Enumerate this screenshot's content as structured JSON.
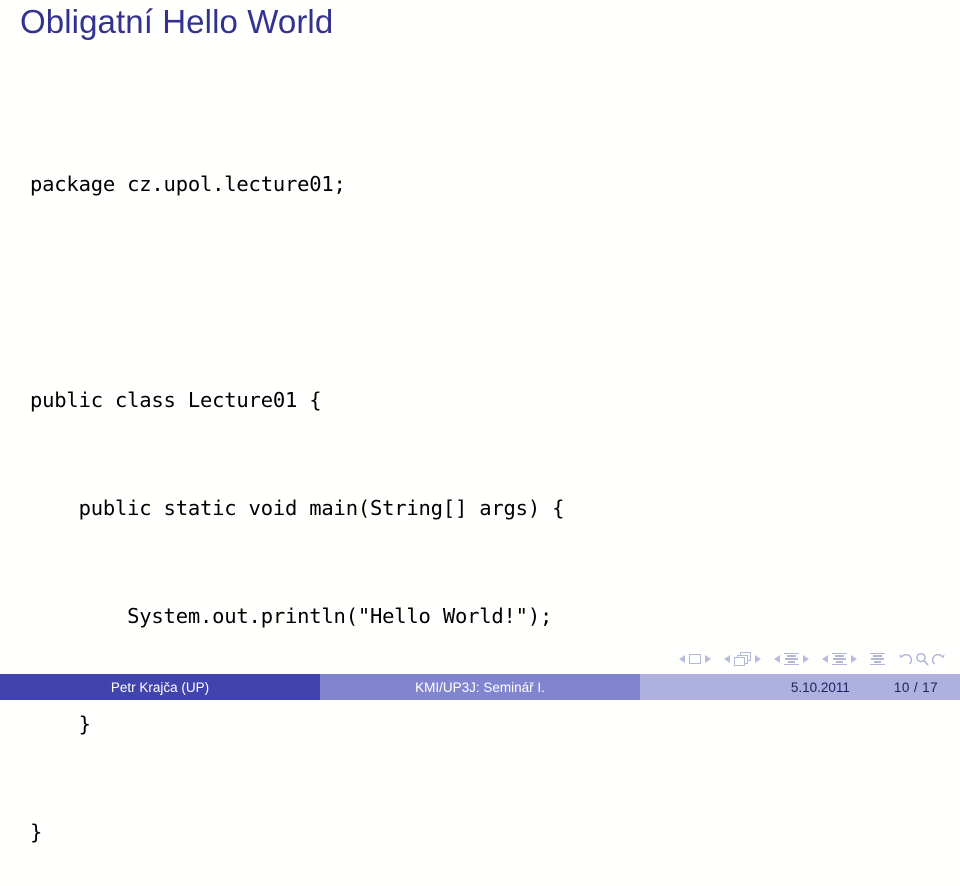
{
  "slide": {
    "title": "Obligatní Hello World",
    "title_color": "#33338f",
    "background_color": "#fffffd"
  },
  "code": {
    "language": "java",
    "lines": [
      "package cz.upol.lecture01;",
      "",
      "public class Lecture01 {",
      "    public static void main(String[] args) {",
      "        System.out.println(\"Hello World!\");",
      "    }",
      "}"
    ]
  },
  "navigation": {
    "color": "#b3b7d9",
    "items": [
      {
        "name": "slide-prev",
        "icon": "triangle-left-icon"
      },
      {
        "name": "slide-marker",
        "icon": "slide-square-icon"
      },
      {
        "name": "slide-next",
        "icon": "triangle-right-icon"
      },
      {
        "name": "frame-prev",
        "icon": "triangle-left-icon"
      },
      {
        "name": "frame-marker",
        "icon": "frame-stack-icon"
      },
      {
        "name": "frame-next",
        "icon": "triangle-right-icon"
      },
      {
        "name": "subsection-prev",
        "icon": "triangle-left-icon"
      },
      {
        "name": "subsection-marker",
        "icon": "lines-icon"
      },
      {
        "name": "subsection-next",
        "icon": "triangle-right-icon"
      },
      {
        "name": "section-prev",
        "icon": "triangle-left-icon"
      },
      {
        "name": "section-marker",
        "icon": "lines-icon"
      },
      {
        "name": "section-next",
        "icon": "triangle-right-icon"
      },
      {
        "name": "presentation-marker",
        "icon": "lines-icon"
      },
      {
        "name": "back-button",
        "icon": "undo-arrow-icon"
      },
      {
        "name": "find-button",
        "icon": "magnifier-icon"
      },
      {
        "name": "forward-button",
        "icon": "redo-arrow-icon"
      }
    ]
  },
  "footer": {
    "author": "Petr Krajča  (UP)",
    "subject": "KMI/UP3J: Seminář I.",
    "date": "5.10.2011",
    "page": "10 / 17",
    "author_bg": "#4244ad",
    "subject_bg": "#8185cf",
    "meta_bg": "#aeb1e0"
  }
}
